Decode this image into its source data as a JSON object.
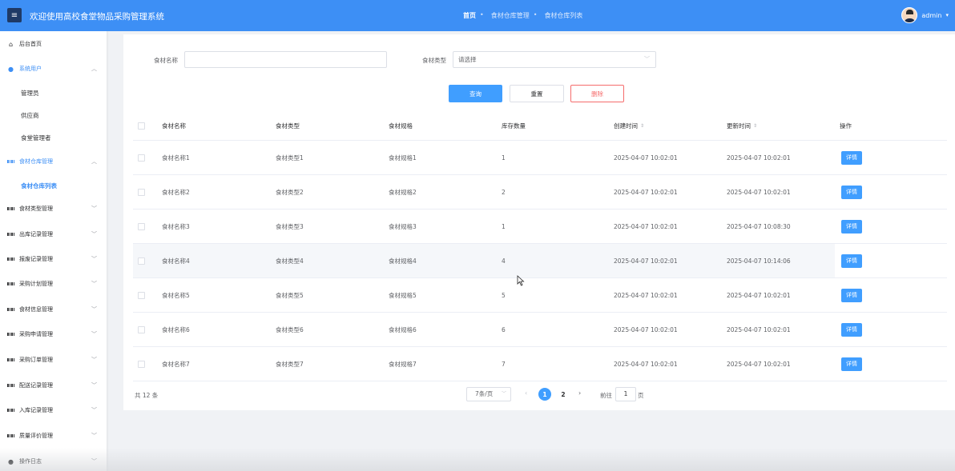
{
  "header": {
    "menu_icon": "hamburger-icon",
    "title": "欢迎使用高校食堂物品采购管理系统",
    "breadcrumbs": [
      {
        "label": "首页",
        "sep": "•"
      },
      {
        "label": "食材仓库管理",
        "sep": "•"
      },
      {
        "label": "食材仓库列表",
        "sep": ""
      }
    ],
    "username": "admin",
    "caret": "▾"
  },
  "sidebar": {
    "home": {
      "label": "后台首页",
      "icon": "home-icon"
    },
    "system_user": {
      "label": "系统用户",
      "icon": "user-icon",
      "arrow": "︿"
    },
    "system_user_children": [
      "管理员",
      "供应商",
      "食堂管理者"
    ],
    "warehouse": {
      "label": "食材仓库管理",
      "icon": "grid-icon",
      "arrow": "︿"
    },
    "warehouse_children": [
      "食材仓库列表"
    ],
    "menus": [
      {
        "label": "食材类型管理",
        "arrow": "﹀"
      },
      {
        "label": "出库记录管理",
        "arrow": "﹀"
      },
      {
        "label": "报废记录管理",
        "arrow": "﹀"
      },
      {
        "label": "采购计划管理",
        "arrow": "﹀"
      },
      {
        "label": "食材信息管理",
        "arrow": "﹀"
      },
      {
        "label": "采购申请管理",
        "arrow": "﹀"
      },
      {
        "label": "采购订单管理",
        "arrow": "﹀"
      },
      {
        "label": "配送记录管理",
        "arrow": "﹀"
      },
      {
        "label": "入库记录管理",
        "arrow": "﹀"
      },
      {
        "label": "质量评价管理",
        "arrow": "﹀"
      }
    ],
    "log": {
      "label": "操作日志",
      "icon": "user-icon",
      "arrow": "﹀"
    }
  },
  "search": {
    "name_label": "食材名称",
    "name_value": "",
    "type_label": "食材类型",
    "type_placeholder": "请选择",
    "type_caret": "﹀",
    "query_label": "查询",
    "reset_label": "重置",
    "delete_label": "删除"
  },
  "table": {
    "columns": [
      "食材名称",
      "食材类型",
      "食材规格",
      "库存数量",
      "创建时间",
      "更新时间",
      "操作"
    ],
    "sort_icon": "⇕",
    "rows": [
      {
        "name": "食材名称1",
        "type": "食材类型1",
        "spec": "食材规格1",
        "qty": "1",
        "created": "2025-04-07 10:02:01",
        "updated": "2025-04-07 10:02:01",
        "action": "详情"
      },
      {
        "name": "食材名称2",
        "type": "食材类型2",
        "spec": "食材规格2",
        "qty": "2",
        "created": "2025-04-07 10:02:01",
        "updated": "2025-04-07 10:02:01",
        "action": "详情"
      },
      {
        "name": "食材名称3",
        "type": "食材类型3",
        "spec": "食材规格3",
        "qty": "1",
        "created": "2025-04-07 10:02:01",
        "updated": "2025-04-07 10:08:30",
        "action": "详情"
      },
      {
        "name": "食材名称4",
        "type": "食材类型4",
        "spec": "食材规格4",
        "qty": "4",
        "created": "2025-04-07 10:02:01",
        "updated": "2025-04-07 10:14:06",
        "action": "详情"
      },
      {
        "name": "食材名称5",
        "type": "食材类型5",
        "spec": "食材规格5",
        "qty": "5",
        "created": "2025-04-07 10:02:01",
        "updated": "2025-04-07 10:02:01",
        "action": "详情"
      },
      {
        "name": "食材名称6",
        "type": "食材类型6",
        "spec": "食材规格6",
        "qty": "6",
        "created": "2025-04-07 10:02:01",
        "updated": "2025-04-07 10:02:01",
        "action": "详情"
      },
      {
        "name": "食材名称7",
        "type": "食材类型7",
        "spec": "食材规格7",
        "qty": "7",
        "created": "2025-04-07 10:02:01",
        "updated": "2025-04-07 10:02:01",
        "action": "详情"
      }
    ]
  },
  "pagination": {
    "total": "共 12 条",
    "page_size": "7条/页",
    "page_size_caret": "﹀",
    "prev": "‹",
    "next": "›",
    "pages": [
      "1",
      "2"
    ],
    "current": "1",
    "goto_prefix": "前往",
    "goto_value": "1",
    "goto_suffix": "页"
  },
  "colors": {
    "primary": "#409eff",
    "header": "#3d8ff5",
    "danger": "#f56c6c"
  }
}
